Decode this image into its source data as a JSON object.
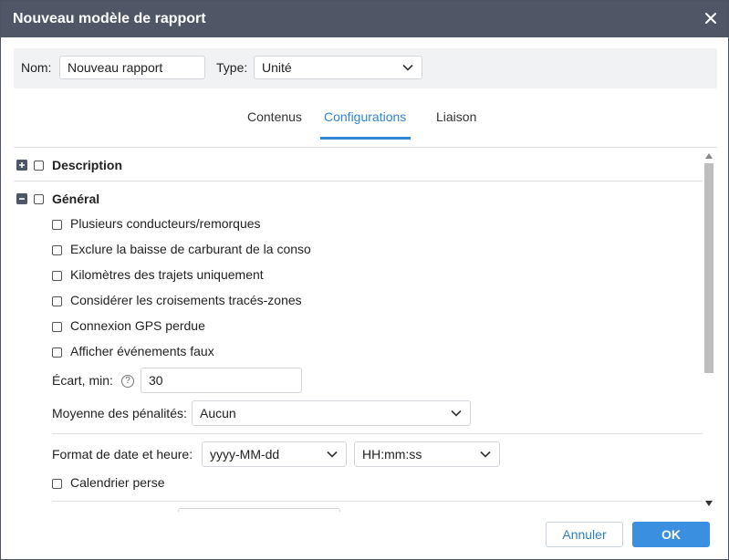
{
  "window": {
    "title": "Nouveau modèle de rapport"
  },
  "header": {
    "name_label": "Nom:",
    "name_value": "Nouveau rapport",
    "type_label": "Type:",
    "type_value": "Unité"
  },
  "tabs": [
    {
      "label": "Contenus",
      "active": false
    },
    {
      "label": "Configurations",
      "active": true
    },
    {
      "label": "Liaison",
      "active": false
    }
  ],
  "sections": {
    "description": {
      "label": "Description",
      "expanded": false,
      "checked": false
    },
    "general": {
      "label": "Général",
      "expanded": true,
      "checked": false,
      "options": [
        {
          "label": "Plusieurs conducteurs/remorques",
          "checked": false
        },
        {
          "label": "Exclure la baisse de carburant de la conso",
          "checked": false
        },
        {
          "label": "Kilomètres des trajets uniquement",
          "checked": false
        },
        {
          "label": "Considérer les croisements tracés-zones",
          "checked": false
        },
        {
          "label": "Connexion GPS perdue",
          "checked": false
        },
        {
          "label": "Afficher événements faux",
          "checked": false
        }
      ],
      "gap_label": "Écart, min:",
      "gap_help_icon": "?",
      "gap_value": "30",
      "penalty_label": "Moyenne des pénalités:",
      "penalty_value": "Aucun",
      "datetime_label": "Format de date et heure:",
      "date_format": "yyyy-MM-dd",
      "time_format": "HH:mm:ss",
      "persian_calendar": {
        "label": "Calendrier perse",
        "checked": false
      }
    }
  },
  "footer": {
    "cancel_label": "Annuler",
    "ok_label": "OK"
  },
  "colors": {
    "titlebar": "#4f5766",
    "accent": "#2f86d6",
    "ok_button": "#3b8fe0"
  },
  "icons": {
    "close": "close-icon",
    "expand": "plus-box-icon",
    "collapse": "minus-box-icon",
    "dropdown": "chevron-down-icon",
    "help": "help-circle-icon"
  }
}
